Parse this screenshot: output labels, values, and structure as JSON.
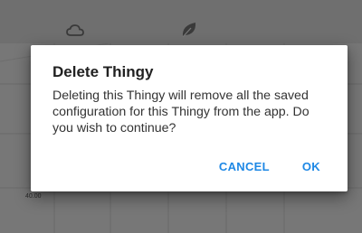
{
  "background": {
    "icons": [
      "cloud-icon",
      "leaf-icon"
    ],
    "axis_label": "40.00"
  },
  "dialog": {
    "title": "Delete Thingy",
    "message": "Deleting this Thingy will remove all the saved configuration for this Thingy from the app. Do you wish to continue?",
    "cancel_label": "CANCEL",
    "ok_label": "OK"
  },
  "colors": {
    "accent": "#1e88e5",
    "scrim": "#6b6b6b",
    "dialog_bg": "#ffffff"
  }
}
